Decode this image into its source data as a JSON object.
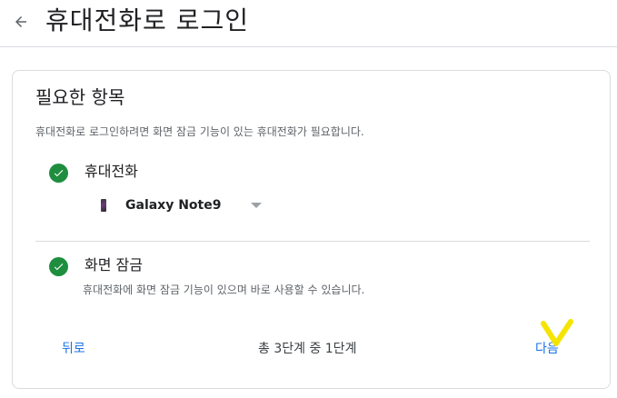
{
  "header": {
    "title": "휴대전화로 로그인",
    "back_icon": "arrow-left-icon"
  },
  "card": {
    "title": "필요한 항목",
    "description": "휴대전화로 로그인하려면 화면 잠금 기능이 있는 휴대전화가 필요합니다.",
    "requirements": [
      {
        "label": "휴대전화",
        "icon": "check-circle-icon",
        "status_color": "#1e8e3e"
      },
      {
        "label": "화면 잠금",
        "sub": "휴대전화에 화면 잠금 기능이 있으며 바로 사용할 수 있습니다.",
        "icon": "check-circle-icon",
        "status_color": "#1e8e3e"
      }
    ],
    "device": {
      "name": "Galaxy Note9",
      "icon": "phone-icon"
    }
  },
  "footer": {
    "back_label": "뒤로",
    "step_text": "총 3단계 중 1단계",
    "next_label": "다음"
  },
  "colors": {
    "accent": "#1a73e8",
    "success": "#1e8e3e",
    "highlight": "#f5e400"
  }
}
